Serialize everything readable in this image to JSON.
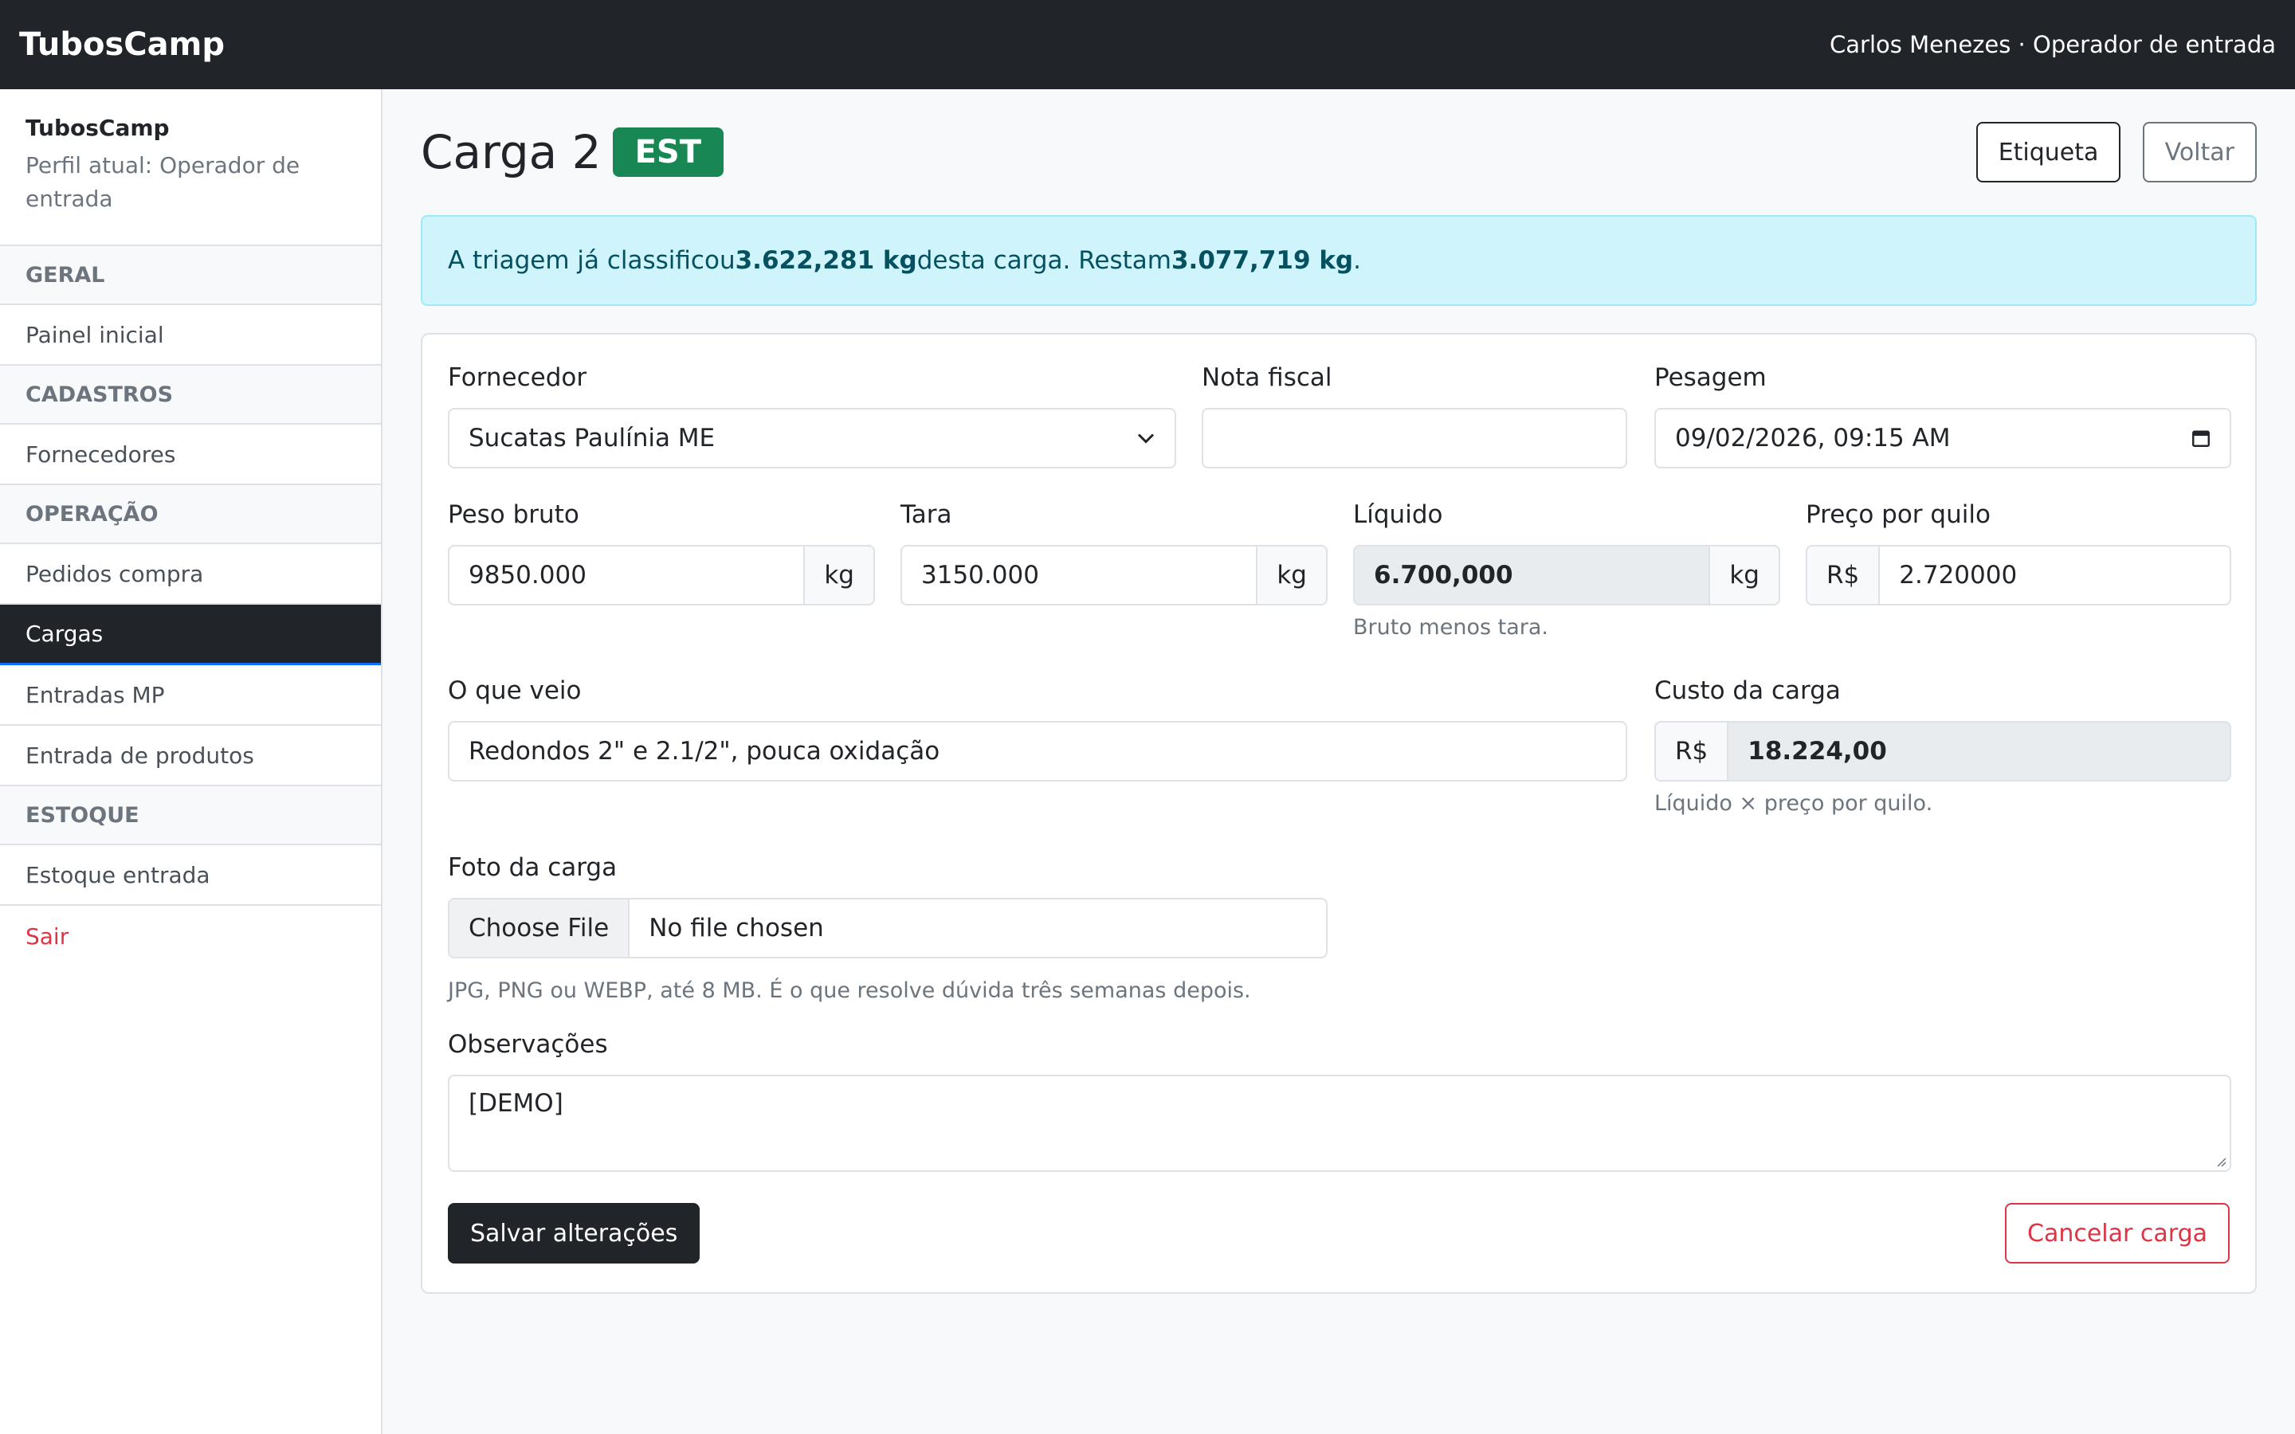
{
  "topbar": {
    "brand": "TubosCamp",
    "user": "Carlos Menezes · Operador de entrada"
  },
  "sidebar": {
    "title": "TubosCamp",
    "subtitle": "Perfil atual: Operador de entrada",
    "groups": [
      "GERAL",
      "CADASTROS",
      "OPERAÇÃO",
      "ESTOQUE"
    ],
    "items": {
      "painel": "Painel inicial",
      "fornecedores": "Fornecedores",
      "pedidos": "Pedidos compra",
      "cargas": "Cargas",
      "entradas_mp": "Entradas MP",
      "entrada_produtos": "Entrada de produtos",
      "estoque_entrada": "Estoque entrada",
      "sair": "Sair"
    }
  },
  "page": {
    "title": "Carga 2",
    "badge": "EST",
    "btn_etiqueta": "Etiqueta",
    "btn_voltar": "Voltar"
  },
  "alert": {
    "pre": "A triagem já classificou ",
    "classified": "3.622,281 kg",
    "mid": " desta carga. Restam ",
    "remaining": "3.077,719 kg",
    "post": "."
  },
  "form": {
    "fornecedor_label": "Fornecedor",
    "fornecedor_value": "Sucatas Paulínia ME",
    "nota_label": "Nota fiscal",
    "nota_value": "",
    "pesagem_label": "Pesagem",
    "pesagem_value": "09/02/2026, 09:15 AM",
    "bruto_label": "Peso bruto",
    "bruto_value": "9850.000",
    "tara_label": "Tara",
    "tara_value": "3150.000",
    "liquido_label": "Líquido",
    "liquido_value": "6.700,000",
    "liquido_help": "Bruto menos tara.",
    "unit_kg": "kg",
    "preco_label": "Preço por quilo",
    "currency": "R$",
    "preco_value": "2.720000",
    "veio_label": "O que veio",
    "veio_value": "Redondos 2\" e 2.1/2\", pouca oxidação",
    "custo_label": "Custo da carga",
    "custo_value": "18.224,00",
    "custo_help": "Líquido × preço por quilo.",
    "foto_label": "Foto da carga",
    "file_button": "Choose File",
    "file_name": "No file chosen",
    "foto_help": "JPG, PNG ou WEBP, até 8 MB. É o que resolve dúvida três semanas depois.",
    "obs_label": "Observações",
    "obs_value": "[DEMO]",
    "save_label": "Salvar alterações",
    "cancel_label": "Cancelar carga"
  }
}
